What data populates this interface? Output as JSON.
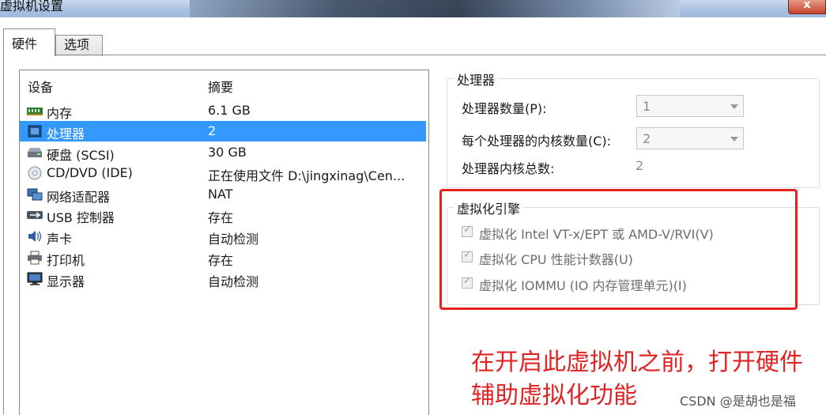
{
  "window": {
    "title": "虚拟机设置",
    "close_label": "x"
  },
  "tabs": [
    {
      "label": "硬件",
      "active": true
    },
    {
      "label": "选项",
      "active": false
    }
  ],
  "device_list": {
    "headers": {
      "device": "设备",
      "summary": "摘要"
    },
    "rows": [
      {
        "name": "内存",
        "summary": "6.1 GB",
        "icon": "memory-icon",
        "selected": false
      },
      {
        "name": "处理器",
        "summary": "2",
        "icon": "processor-icon",
        "selected": true
      },
      {
        "name": "硬盘 (SCSI)",
        "summary": "30 GB",
        "icon": "harddisk-icon",
        "selected": false
      },
      {
        "name": "CD/DVD (IDE)",
        "summary": "正在使用文件 D:\\jingxinag\\Cen...",
        "icon": "cd-dvd-icon",
        "selected": false
      },
      {
        "name": "网络适配器",
        "summary": "NAT",
        "icon": "network-adapter-icon",
        "selected": false
      },
      {
        "name": "USB 控制器",
        "summary": "存在",
        "icon": "usb-icon",
        "selected": false
      },
      {
        "name": "声卡",
        "summary": "自动检测",
        "icon": "speaker-icon",
        "selected": false
      },
      {
        "name": "打印机",
        "summary": "存在",
        "icon": "printer-icon",
        "selected": false
      },
      {
        "name": "显示器",
        "summary": "自动检测",
        "icon": "monitor-icon",
        "selected": false
      }
    ]
  },
  "processor": {
    "legend": "处理器",
    "count_label": "处理器数量(P):",
    "count_value": "1",
    "cores_label": "每个处理器的内核数量(C):",
    "cores_value": "2",
    "total_label": "处理器内核总数:",
    "total_value": "2"
  },
  "virtualization": {
    "legend": "虚拟化引擎",
    "options": [
      {
        "label": "虚拟化 Intel VT-x/EPT 或 AMD-V/RVI(V)",
        "checked": true
      },
      {
        "label": "虚拟化 CPU 性能计数器(U)",
        "checked": true
      },
      {
        "label": "虚拟化 IOMMU (IO 内存管理单元)(I)",
        "checked": true
      }
    ]
  },
  "annotation": {
    "line1": "在开启此虚拟机之前，打开硬件",
    "line2": "辅助虚拟化功能",
    "color": "#e02424"
  },
  "watermark": "CSDN @是胡也是福",
  "colors": {
    "selection": "#3399ff",
    "highlight_box": "#e61f1f"
  }
}
